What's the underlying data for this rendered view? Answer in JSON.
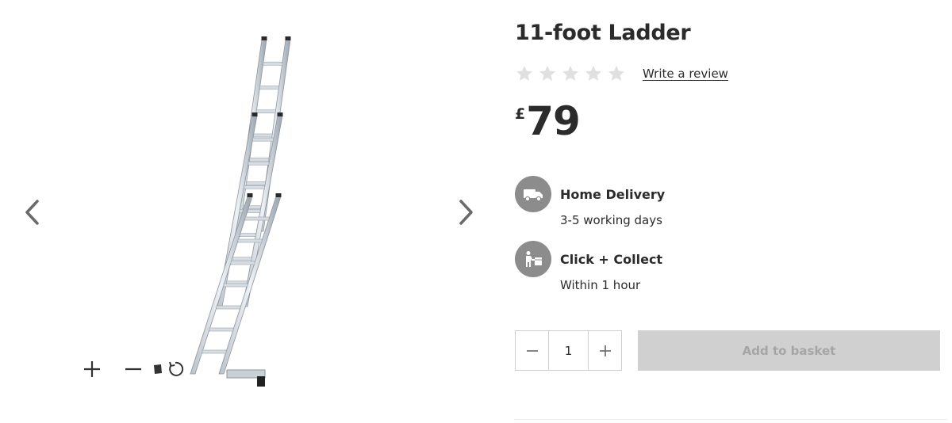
{
  "product": {
    "title": "11-foot Ladder",
    "rating": {
      "stars_filled": 0,
      "stars_total": 5,
      "write_review_label": "Write a review"
    },
    "price": {
      "currency_symbol": "£",
      "amount": "79"
    }
  },
  "fulfilment": [
    {
      "icon": "delivery-truck-icon",
      "title": "Home Delivery",
      "subtitle": "3-5 working days"
    },
    {
      "icon": "click-collect-icon",
      "title": "Click + Collect",
      "subtitle": "Within 1 hour"
    }
  ],
  "purchase": {
    "quantity": "1",
    "add_to_basket_label": "Add to basket",
    "add_to_basket_enabled": false
  },
  "gallery": {
    "image_subject": "extension ladder",
    "controls": [
      "zoom-in-icon",
      "zoom-out-icon",
      "drag-handle-icon",
      "reset-icon"
    ]
  },
  "colors": {
    "text": "#2b2b2b",
    "icon_circle": "#8c8c8c",
    "star_empty": "#e0e0e0",
    "button_disabled_bg": "#d0d0d0",
    "button_disabled_text": "#a5a5a5"
  }
}
